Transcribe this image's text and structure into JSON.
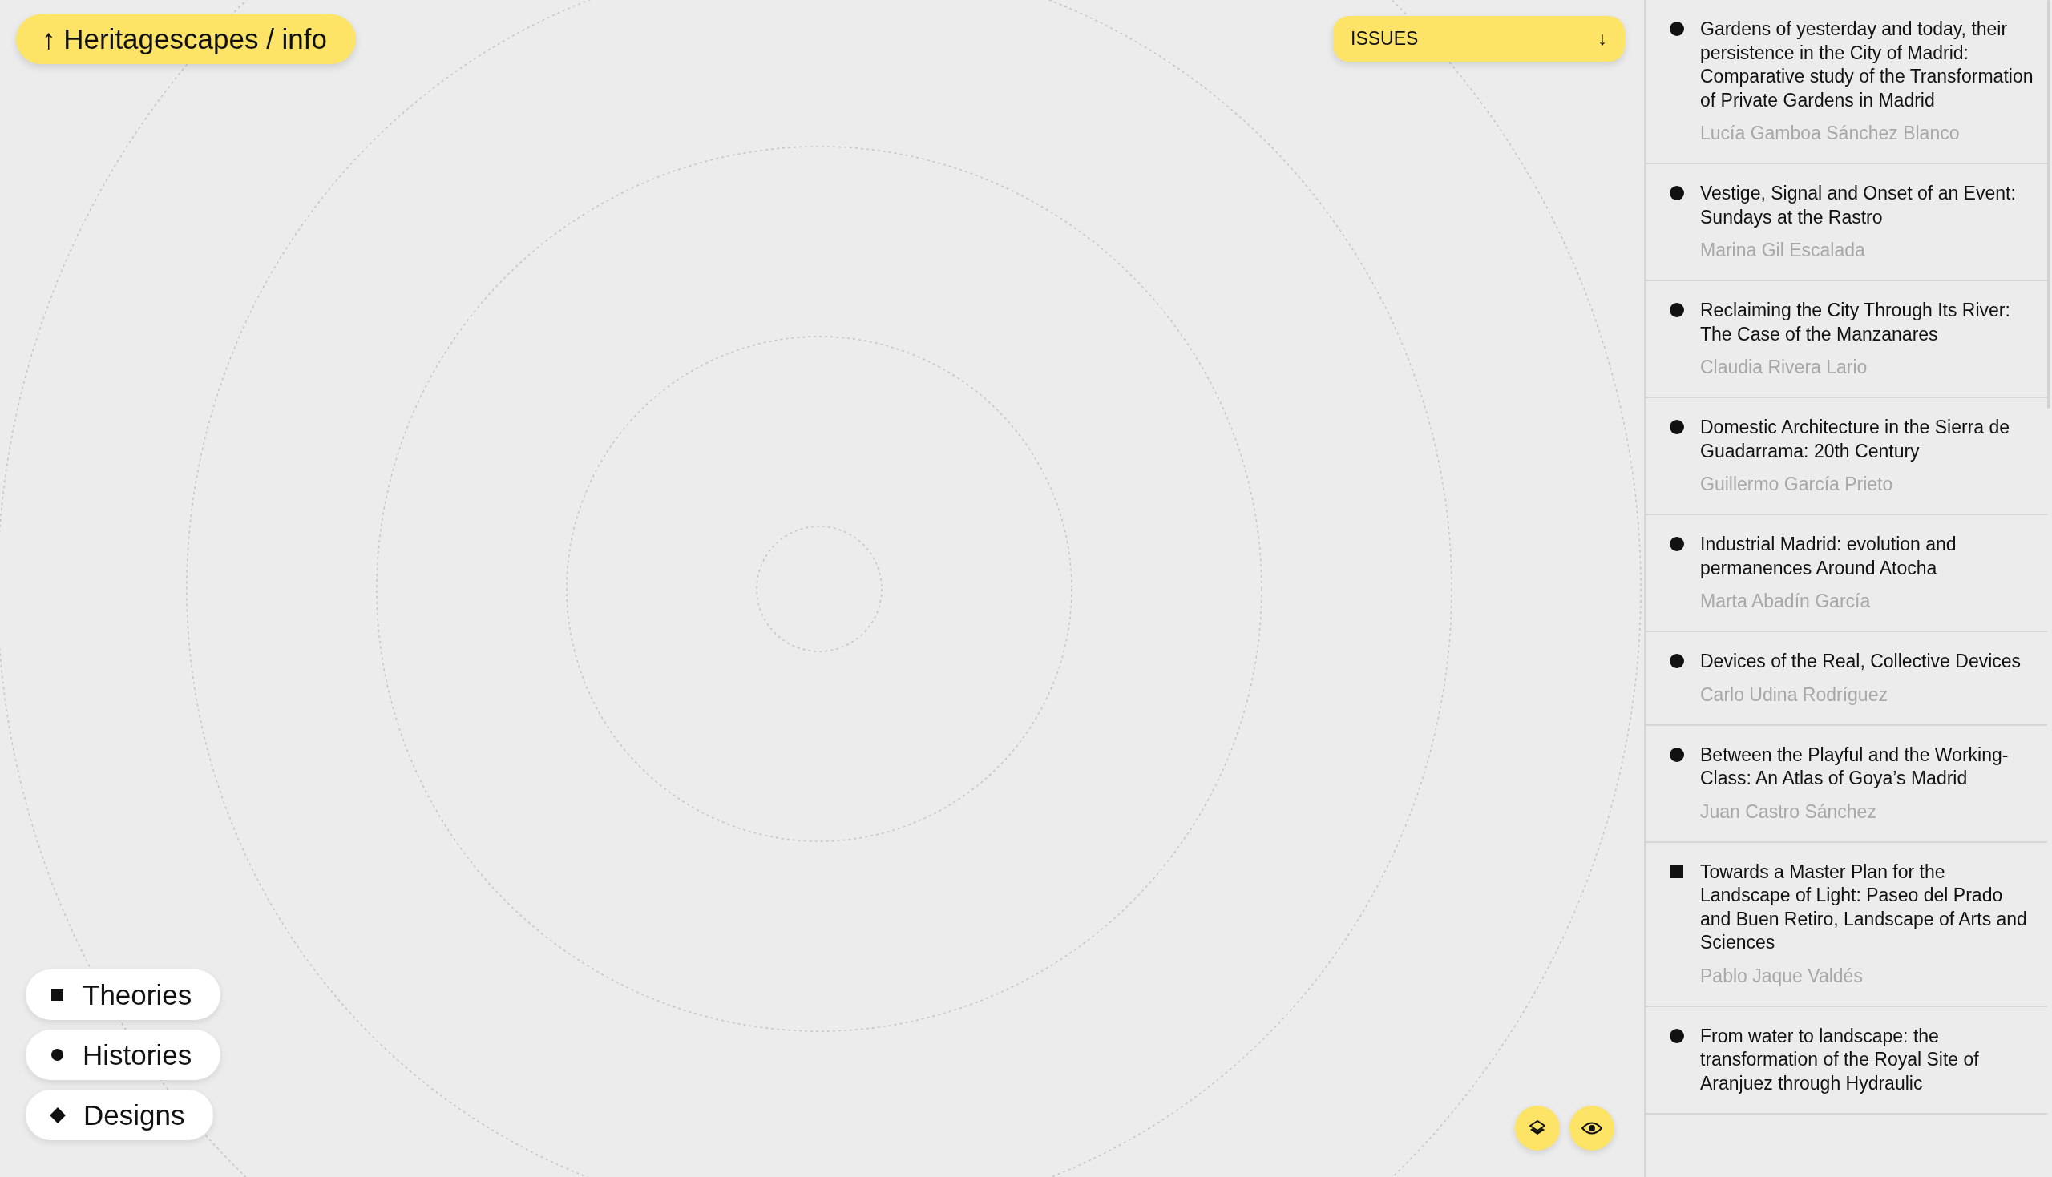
{
  "home_link": {
    "label": "Heritagescapes / info",
    "arrow": "↑"
  },
  "issues_dropdown": {
    "label": "ISSUES",
    "arrow": "↓"
  },
  "legend": [
    {
      "kind": "square",
      "label": "Theories"
    },
    {
      "kind": "circle",
      "label": "Histories"
    },
    {
      "kind": "diamond",
      "label": "Designs"
    }
  ],
  "map_controls": [
    {
      "kind": "layers"
    },
    {
      "kind": "eye"
    }
  ],
  "articles": [
    {
      "kind": "circle",
      "title": "Gardens of yesterday and today, their persistence in the City of Madrid: Comparative study of the Transformation of Private Gardens in Madrid",
      "author": "Lucía Gamboa Sánchez Blanco"
    },
    {
      "kind": "circle",
      "title": "Vestige, Signal and Onset of an Event: Sundays at the Rastro",
      "author": "Marina Gil Escalada"
    },
    {
      "kind": "circle",
      "title": "Reclaiming the City Through Its River: The Case of the Manzanares",
      "author": "Claudia Rivera Lario"
    },
    {
      "kind": "circle",
      "title": "Domestic Architecture in the Sierra de Guadarrama: 20th Century",
      "author": "Guillermo García Prieto"
    },
    {
      "kind": "circle",
      "title": "Industrial Madrid: evolution and permanences Around Atocha",
      "author": "Marta Abadín García"
    },
    {
      "kind": "circle",
      "title": "Devices of the Real, Collective Devices",
      "author": "Carlo Udina Rodríguez"
    },
    {
      "kind": "circle",
      "title": "Between the Playful and the Working-Class: An Atlas of Goya’s Madrid",
      "author": "Juan Castro Sánchez"
    },
    {
      "kind": "square",
      "title": "Towards a Master Plan for the Landscape of Light: Paseo del Prado and Buen Retiro, Landscape of Arts and Sciences",
      "author": "Pablo Jaque Valdés"
    },
    {
      "kind": "circle",
      "title": "From water to landscape: the transformation of the Royal Site of Aranjuez through Hydraulic"
    }
  ]
}
